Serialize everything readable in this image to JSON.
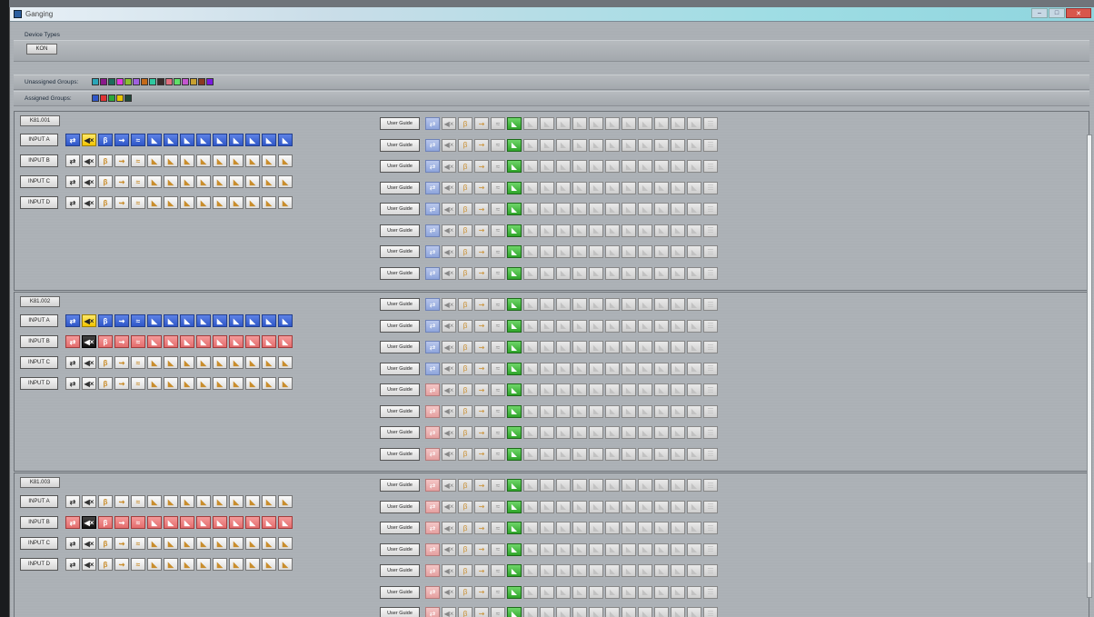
{
  "window": {
    "title": "Ganging",
    "btn_min": "–",
    "btn_max": "□",
    "btn_close": "✕"
  },
  "device_types": {
    "label": "Device Types",
    "button": "KON"
  },
  "groups": {
    "unassigned_label": "Unassigned Groups:",
    "unassigned_colors": [
      "#2aa5b8",
      "#8a1a8a",
      "#1b6b5a",
      "#e03adf",
      "#8abf2f",
      "#a060e0",
      "#c46a1a",
      "#2ec7a0",
      "#3a2a2a",
      "#e07080",
      "#5fdf6a",
      "#c455d0",
      "#c8a030",
      "#8a3a20",
      "#7a1ae0"
    ],
    "assigned_label": "Assigned Groups:",
    "assigned_colors": [
      "#2f57c8",
      "#e03434",
      "#2aa83a",
      "#e8c400",
      "#204838"
    ]
  },
  "output_button_label": "User Guide",
  "devices": [
    {
      "name": "K81.001",
      "inputs": [
        {
          "label": "INPUT A",
          "color": "blue"
        },
        {
          "label": "INPUT B",
          "color": "none"
        },
        {
          "label": "INPUT C",
          "color": "none"
        },
        {
          "label": "INPUT D",
          "color": "none"
        }
      ],
      "outputs": [
        "blue",
        "blue",
        "blue",
        "blue",
        "blue",
        "blue",
        "blue",
        "blue"
      ]
    },
    {
      "name": "K81.002",
      "inputs": [
        {
          "label": "INPUT A",
          "color": "blue"
        },
        {
          "label": "INPUT B",
          "color": "red"
        },
        {
          "label": "INPUT C",
          "color": "none"
        },
        {
          "label": "INPUT D",
          "color": "none"
        }
      ],
      "outputs": [
        "blue",
        "blue",
        "blue",
        "blue",
        "red",
        "red",
        "red",
        "red"
      ]
    },
    {
      "name": "K81.003",
      "inputs": [
        {
          "label": "INPUT A",
          "color": "none"
        },
        {
          "label": "INPUT B",
          "color": "red"
        },
        {
          "label": "INPUT C",
          "color": "none"
        },
        {
          "label": "INPUT D",
          "color": "none"
        }
      ],
      "outputs": [
        "red",
        "red",
        "red",
        "red",
        "red",
        "red",
        "red",
        "red"
      ]
    }
  ],
  "icons": {
    "input_cells": [
      "router-icon",
      "mute-icon",
      "polarity-icon",
      "delay-icon",
      "eq-icon",
      "curve-icon",
      "curve-icon",
      "curve-icon",
      "curve-icon",
      "curve-icon",
      "curve-icon",
      "curve-icon",
      "curve-icon",
      "curve-icon"
    ],
    "input_glyphs": [
      "⇄",
      "◀×",
      "β",
      "⇝",
      "≈",
      "◣",
      "◣",
      "◣",
      "◣",
      "◣",
      "◣",
      "◣",
      "◣",
      "◣"
    ],
    "output_cells": [
      "router-icon",
      "mute-icon",
      "polarity-icon",
      "delay-icon",
      "eq-icon",
      "gain-icon",
      "curve-icon",
      "curve-icon",
      "curve-icon",
      "curve-icon",
      "curve-icon",
      "curve-icon",
      "curve-icon",
      "curve-icon",
      "curve-icon",
      "curve-icon",
      "curve-icon",
      "meter-icon"
    ],
    "output_glyphs": [
      "⇄",
      "◀×",
      "β",
      "⇝",
      "≈",
      "◣",
      "◣",
      "◣",
      "◣",
      "◣",
      "◣",
      "◣",
      "◣",
      "◣",
      "◣",
      "◣",
      "◣",
      "☰"
    ]
  }
}
